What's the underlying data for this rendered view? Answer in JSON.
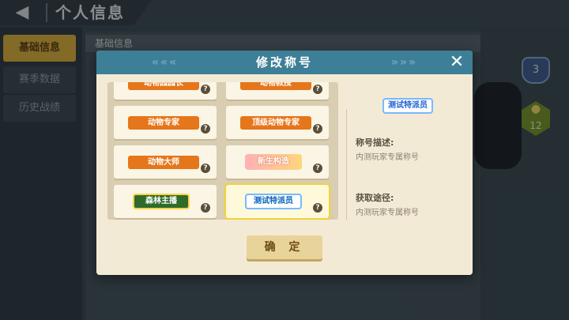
{
  "page": {
    "title": "个人信息",
    "back_icon": "back-arrow-icon"
  },
  "left_tabs": [
    {
      "label": "基础信息",
      "active": true
    },
    {
      "label": "赛季数据",
      "active": false
    },
    {
      "label": "历史战绩",
      "active": false
    }
  ],
  "center": {
    "header": "基础信息"
  },
  "side": {
    "shield_level": "3",
    "paw_level": "12"
  },
  "modal": {
    "title": "修改称号",
    "header_chevrons_left": "«««",
    "header_chevrons_right": "»»»",
    "close_icon": "✕",
    "titles": [
      {
        "label": "动物园园长",
        "style": "pill"
      },
      {
        "label": "动物教授",
        "style": "pill"
      },
      {
        "label": "动物专家",
        "style": "pill"
      },
      {
        "label": "顶级动物专家",
        "style": "pill"
      },
      {
        "label": "动物大师",
        "style": "pill"
      },
      {
        "label": "新生构造",
        "style": "newbie"
      },
      {
        "label": "森林主播",
        "style": "forest"
      },
      {
        "label": "测试特派员",
        "style": "tester",
        "selected": true
      }
    ],
    "preview_title": "测试特派员",
    "desc_label": "称号描述:",
    "desc_value": "内测玩家专属称号",
    "source_label": "获取途径:",
    "source_value": "内测玩家专属称号",
    "confirm_label": "确 定"
  },
  "colors": {
    "header_blue": "#3e7f98",
    "pill_orange": "#e6761b",
    "active_tab_gold": "#e6b535",
    "confirm_button": "#e8d39a"
  }
}
